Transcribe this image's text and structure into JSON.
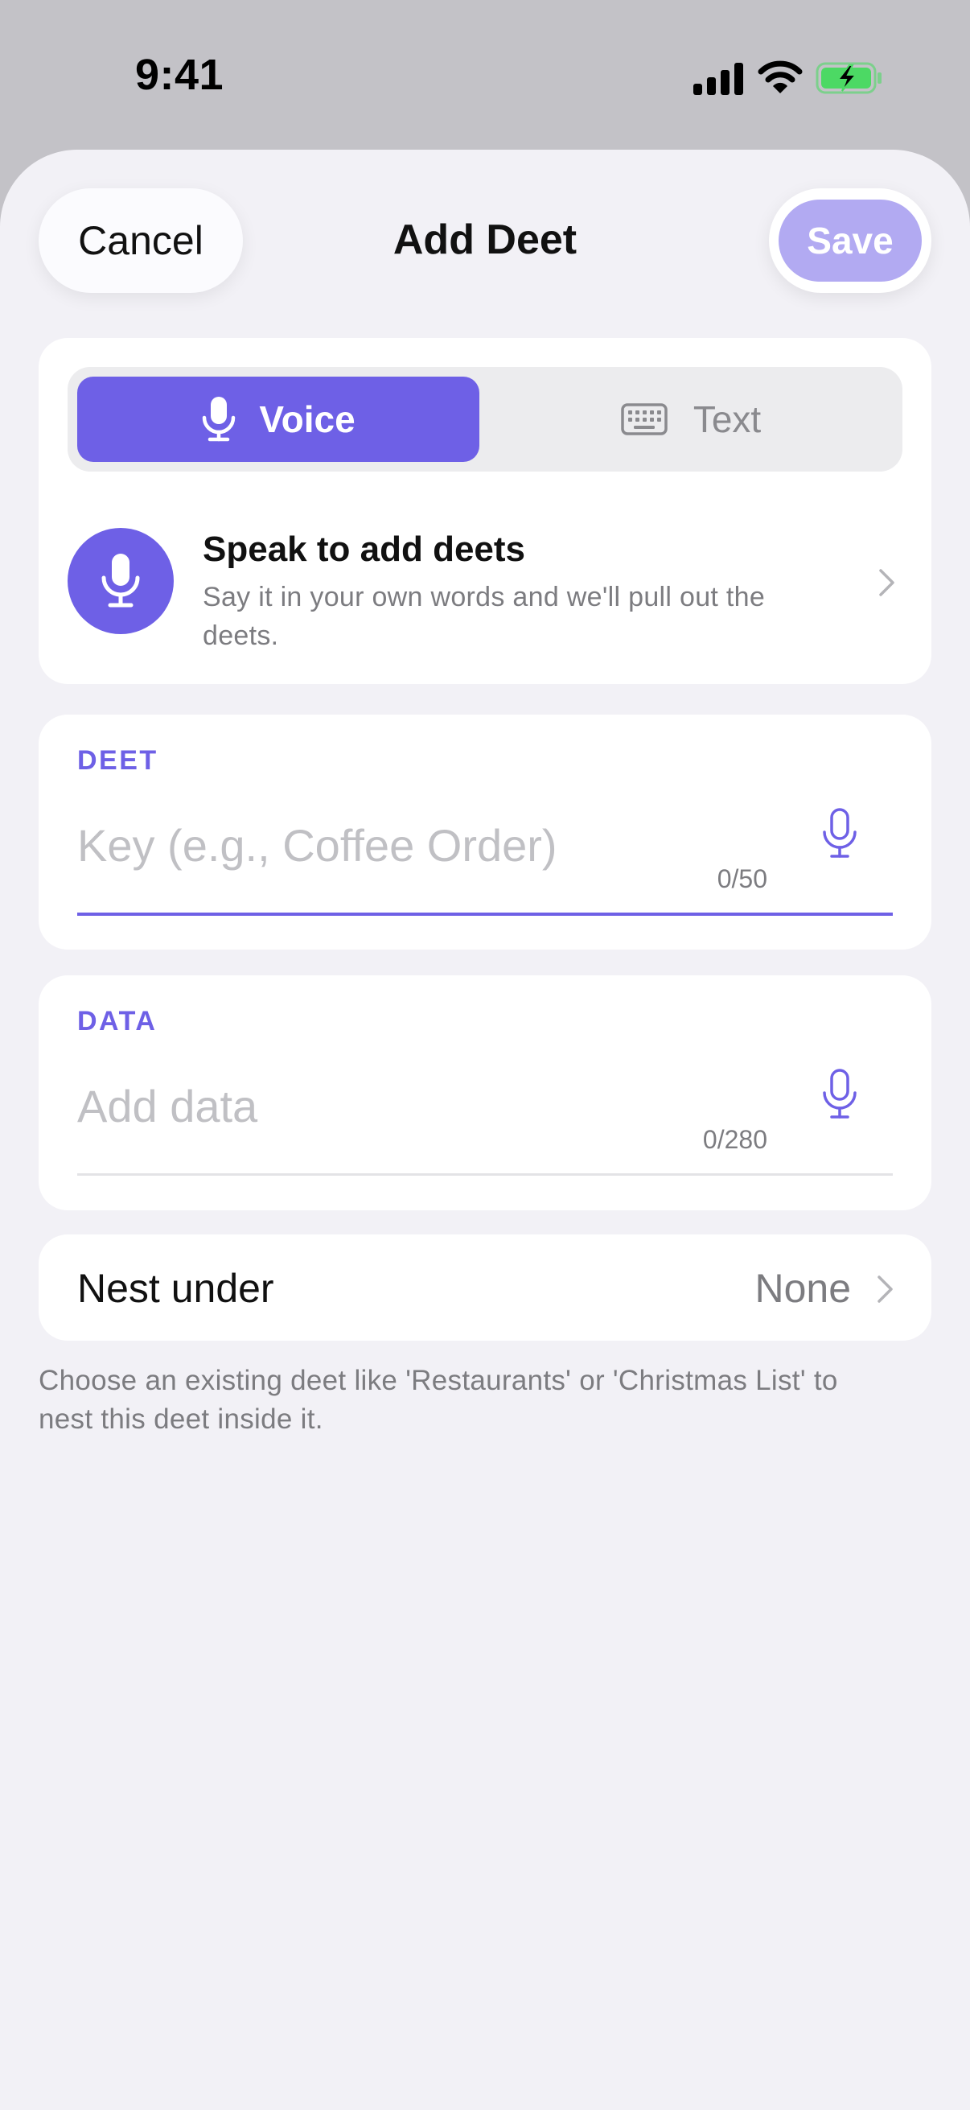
{
  "status_bar": {
    "time": "9:41",
    "icons": [
      "cellular-signal-icon",
      "wifi-icon",
      "battery-charging-icon"
    ]
  },
  "header": {
    "cancel_label": "Cancel",
    "title": "Add Deet",
    "save_label": "Save"
  },
  "mode": {
    "voice_label": "Voice",
    "text_label": "Text",
    "selected": "Voice"
  },
  "speak": {
    "title": "Speak to add deets",
    "subtitle": "Say it in your own words and we'll pull out the deets."
  },
  "deet_field": {
    "label": "DEET",
    "placeholder": "Key (e.g., Coffee Order)",
    "counter": "0/50"
  },
  "data_field": {
    "label": "DATA",
    "placeholder": "Add data",
    "counter": "0/280"
  },
  "nest": {
    "label": "Nest under",
    "value": "None",
    "help": "Choose an existing deet like 'Restaurants' or 'Christmas List' to nest this deet inside it."
  },
  "colors": {
    "accent": "#6e60e6",
    "save_disabled": "#b2aaf2",
    "sheet_background": "#f2f1f6",
    "battery_green": "#4cd964"
  }
}
